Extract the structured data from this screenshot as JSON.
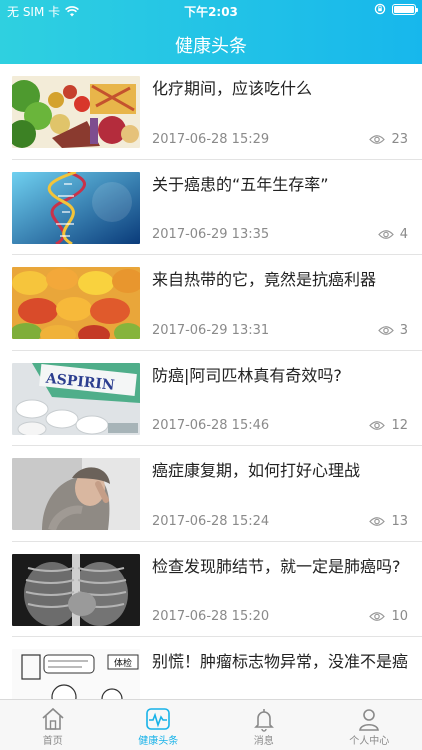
{
  "status": {
    "carrier": "无 SIM 卡",
    "time": "下午2:03"
  },
  "nav": {
    "title": "健康头条"
  },
  "articles": [
    {
      "title": "化疗期间，应该吃什么",
      "date": "2017-06-28 15:29",
      "views": "23"
    },
    {
      "title": "关于癌患的“五年生存率”",
      "date": "2017-06-29 13:35",
      "views": "4"
    },
    {
      "title": "来自热带的它，竟然是抗癌利器",
      "date": "2017-06-29 13:31",
      "views": "3"
    },
    {
      "title": "防癌|阿司匹林真有奇效吗?",
      "date": "2017-06-28 15:46",
      "views": "12",
      "image_text": "ASPIRIN"
    },
    {
      "title": "癌症康复期，如何打好心理战",
      "date": "2017-06-28 15:24",
      "views": "13"
    },
    {
      "title": "检查发现肺结节，就一定是肺癌吗?",
      "date": "2017-06-28 15:20",
      "views": "10"
    },
    {
      "title": "别慌！肿瘤标志物异常，没准不是癌",
      "date": "",
      "views": "",
      "image_text": "体检"
    }
  ],
  "tabs": [
    {
      "label": "首页",
      "icon": "home-icon"
    },
    {
      "label": "健康头条",
      "icon": "pulse-icon",
      "active": true
    },
    {
      "label": "消息",
      "icon": "bell-icon"
    },
    {
      "label": "个人中心",
      "icon": "person-icon"
    }
  ]
}
